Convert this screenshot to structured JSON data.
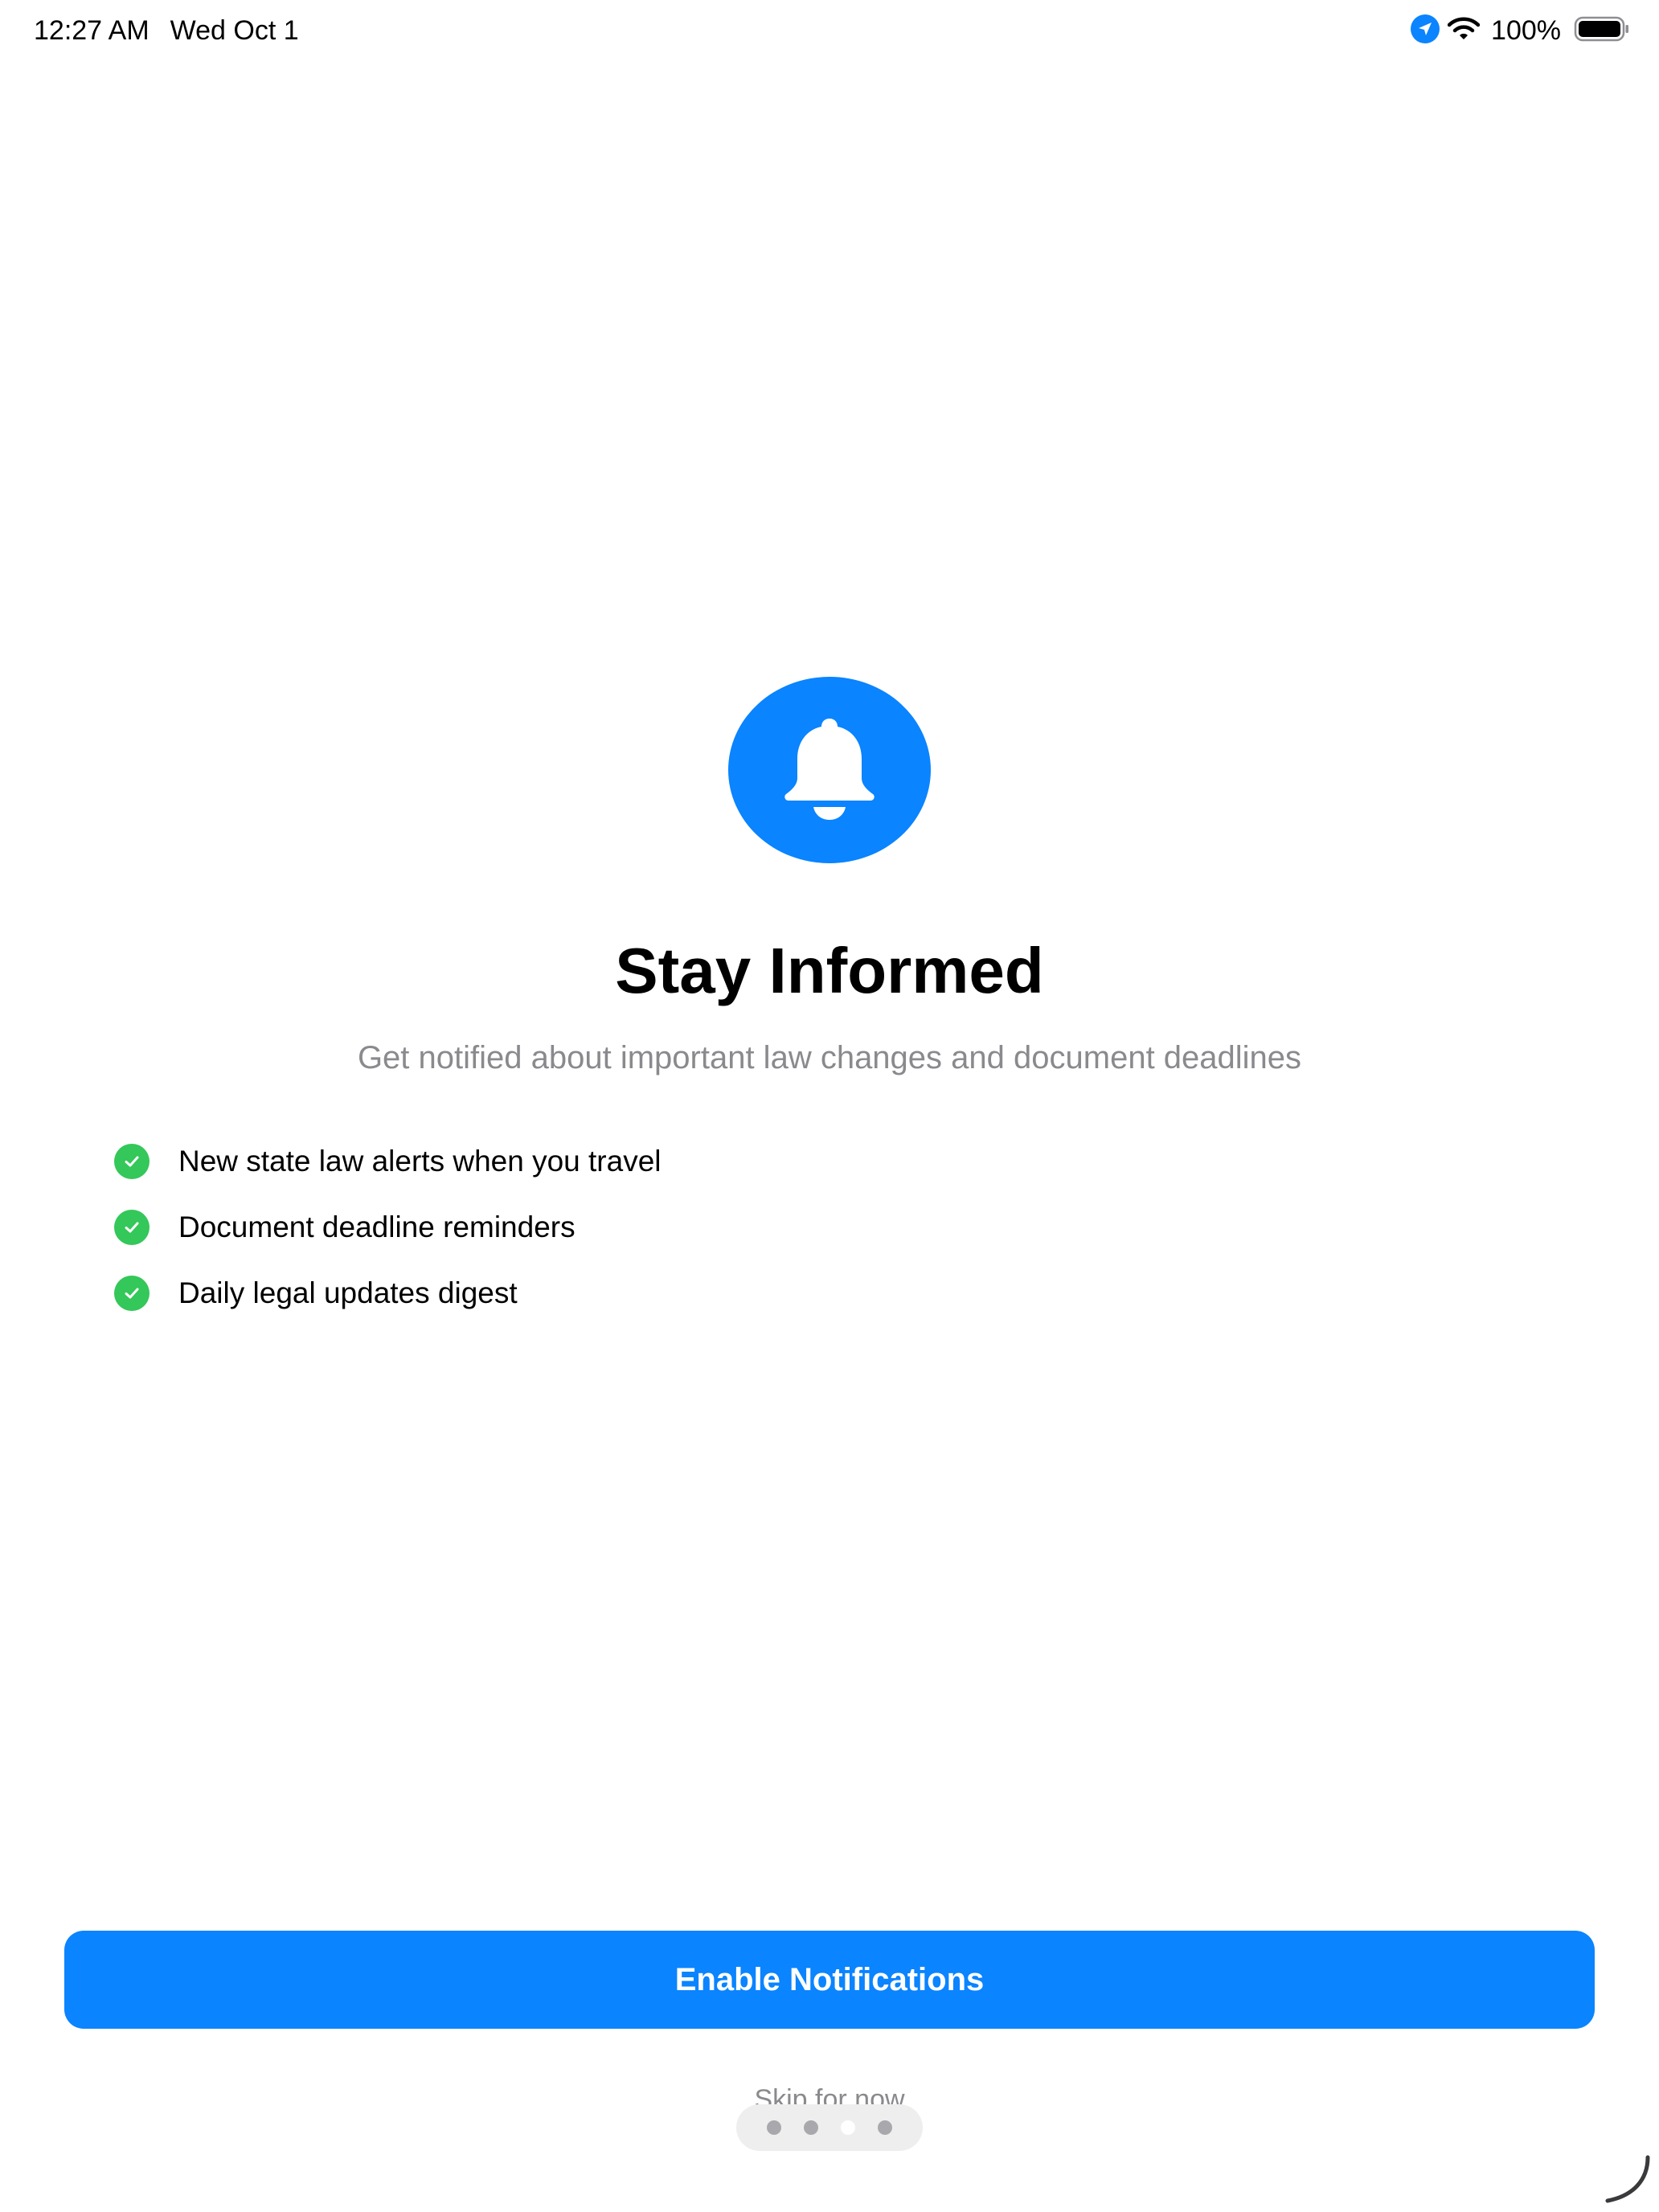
{
  "status_bar": {
    "time": "12:27 AM",
    "date": "Wed Oct 1",
    "battery": "100%",
    "icons": [
      "location-arrow-icon",
      "wifi-icon",
      "battery-icon"
    ]
  },
  "hero": {
    "icon": "bell-icon",
    "title": "Stay Informed",
    "subtitle": "Get notified about important law changes and document deadlines"
  },
  "features": [
    {
      "icon": "checkmark-circle-icon",
      "label": "New state law alerts when you travel"
    },
    {
      "icon": "checkmark-circle-icon",
      "label": "Document deadline reminders"
    },
    {
      "icon": "checkmark-circle-icon",
      "label": "Daily legal updates digest"
    }
  ],
  "actions": {
    "primary_label": "Enable Notifications",
    "secondary_label": "Skip for now"
  },
  "page_indicator": {
    "total": 4,
    "current": 3
  },
  "colors": {
    "accent": "#0a84ff",
    "check": "#34c759",
    "secondary_text": "#8a8a8e"
  }
}
